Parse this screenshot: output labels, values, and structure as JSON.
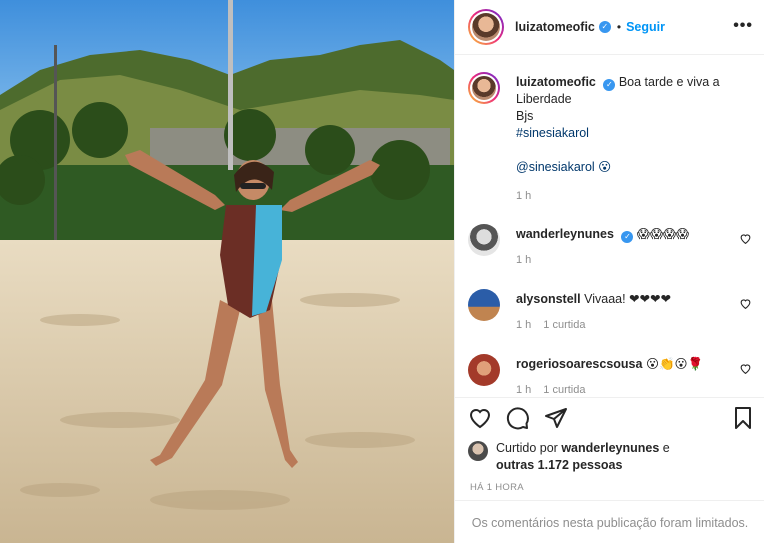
{
  "post": {
    "author": "luizatomeofic",
    "follow_label": "Seguir",
    "separator": "•",
    "more_label": "•••"
  },
  "caption": {
    "username": "luizatomeofic",
    "line1": "Boa tarde e viva a Liberdade",
    "line2": "Bjs",
    "hashtag": "#sinesiakarol",
    "mention": "@sinesiakarol 😮",
    "time": "1 h"
  },
  "comments": [
    {
      "username": "wanderleynunes",
      "verified": true,
      "text": "😱😱😱😱",
      "time": "1 h",
      "likes": ""
    },
    {
      "username": "alysonstell",
      "verified": false,
      "text": "Vivaaa! ❤❤❤❤",
      "time": "1 h",
      "likes": "1 curtida"
    },
    {
      "username": "rogeriosoaresсsousa",
      "verified": false,
      "text": "😮👏😮🌹",
      "time": "1 h",
      "likes": "1 curtida"
    }
  ],
  "likes": {
    "prefix": "Curtido por",
    "user": "wanderleynunes",
    "suffix": "e",
    "others": "outras 1.172 pessoas"
  },
  "timestamp": "HÁ 1 HORA",
  "comments_limited": "Os comentários nesta publicação foram limitados.",
  "colors": {
    "accent": "#0095f6",
    "muted": "#8e8e8e",
    "border": "#efefef"
  }
}
